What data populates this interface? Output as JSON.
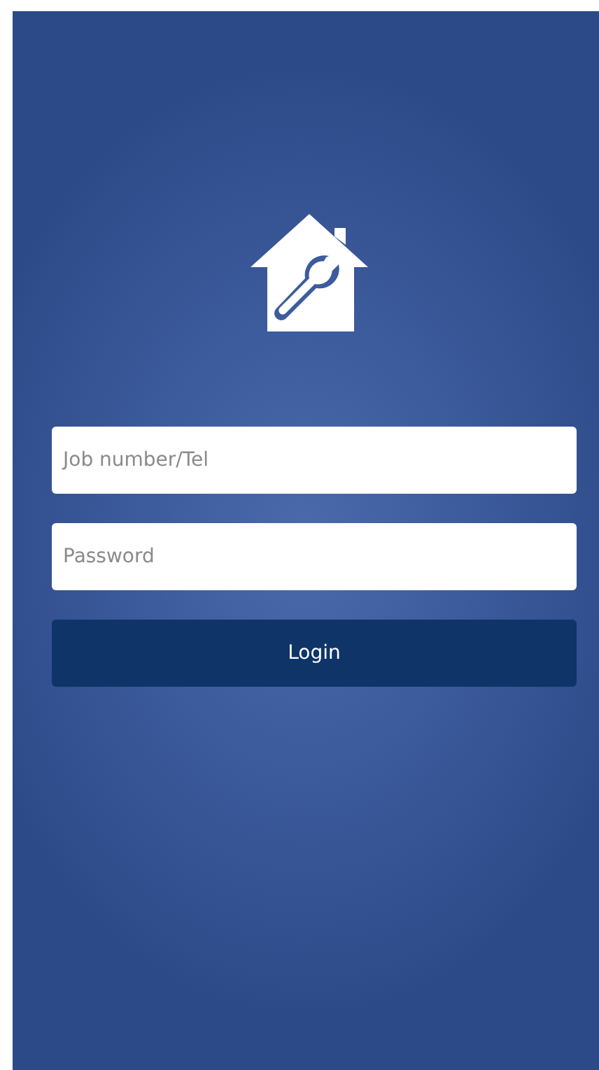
{
  "form": {
    "username": {
      "placeholder": "Job number/Tel"
    },
    "password": {
      "placeholder": "Password"
    },
    "login_button": "Login"
  }
}
